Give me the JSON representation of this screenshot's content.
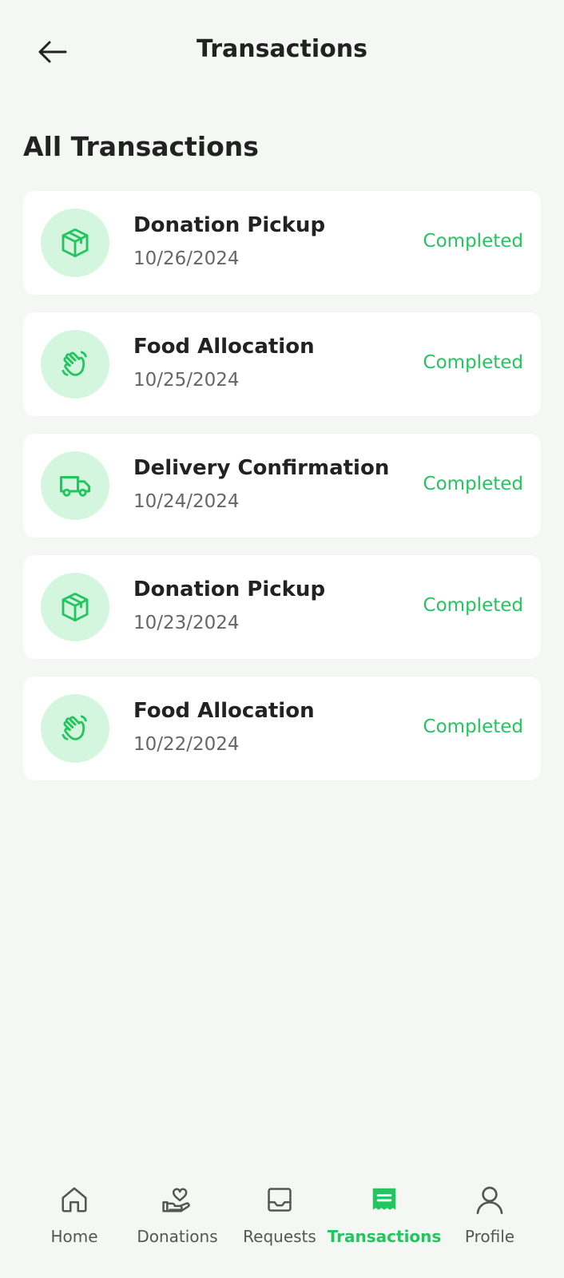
{
  "header": {
    "title": "Transactions",
    "back_icon": "arrow-left-icon"
  },
  "section_title": "All Transactions",
  "colors": {
    "accent": "#22c55e",
    "icon_bg": "#d4f5de",
    "background": "#f5f7f5"
  },
  "transactions": [
    {
      "title": "Donation Pickup",
      "date": "10/26/2024",
      "status": "Completed",
      "icon": "package-icon"
    },
    {
      "title": "Food Allocation",
      "date": "10/25/2024",
      "status": "Completed",
      "icon": "waving-hand-icon"
    },
    {
      "title": "Delivery Confirmation",
      "date": "10/24/2024",
      "status": "Completed",
      "icon": "truck-icon"
    },
    {
      "title": "Donation Pickup",
      "date": "10/23/2024",
      "status": "Completed",
      "icon": "package-icon"
    },
    {
      "title": "Food Allocation",
      "date": "10/22/2024",
      "status": "Completed",
      "icon": "waving-hand-icon"
    }
  ],
  "nav": [
    {
      "label": "Home",
      "icon": "home-icon",
      "active": false
    },
    {
      "label": "Donations",
      "icon": "heart-hand-icon",
      "active": false
    },
    {
      "label": "Requests",
      "icon": "inbox-icon",
      "active": false
    },
    {
      "label": "Transactions",
      "icon": "receipt-icon",
      "active": true
    },
    {
      "label": "Profile",
      "icon": "user-icon",
      "active": false
    }
  ]
}
